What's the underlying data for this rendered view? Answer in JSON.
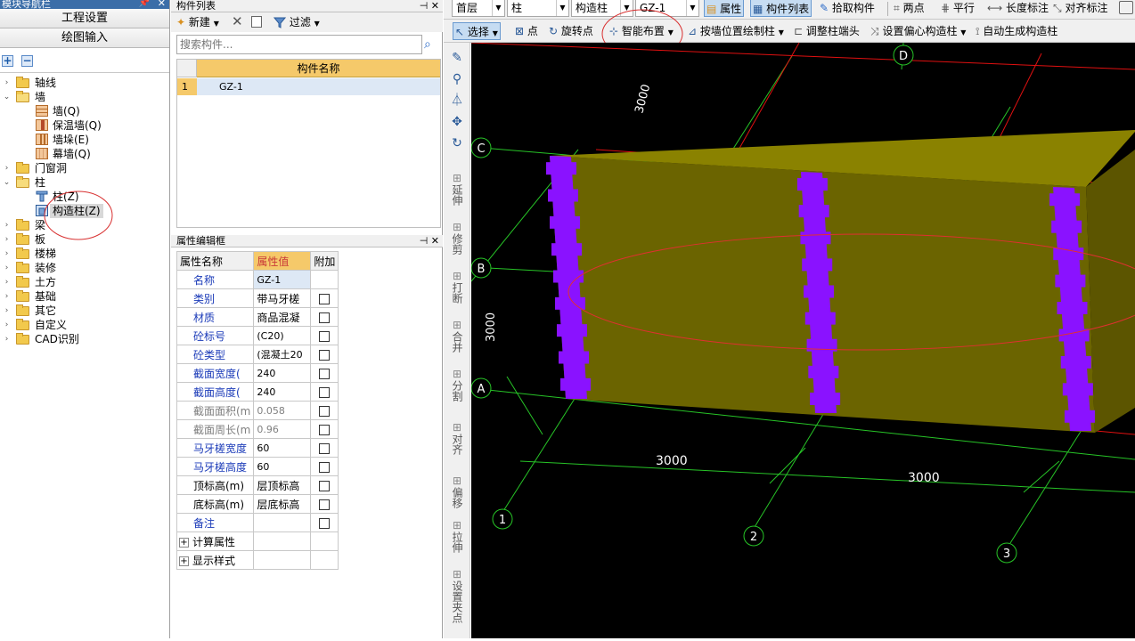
{
  "left_panel": {
    "title": "模块导航栏",
    "buttons": [
      "工程设置",
      "绘图输入"
    ],
    "tree": {
      "axis": "轴线",
      "wall": "墙",
      "wall_children": [
        "墙(Q)",
        "保温墙(Q)",
        "墙垛(E)",
        "幕墙(Q)"
      ],
      "door_window": "门窗洞",
      "column": "柱",
      "column_children": [
        "柱(Z)",
        "构造柱(Z)"
      ],
      "beam": "梁",
      "slab": "板",
      "stair": "楼梯",
      "decoration": "装修",
      "earthwork": "土方",
      "foundation": "基础",
      "other": "其它",
      "custom": "自定义",
      "cad": "CAD识别"
    }
  },
  "component_list": {
    "title": "构件列表",
    "new_label": "新建",
    "filter_label": "过滤",
    "search_placeholder": "搜索构件...",
    "header": "构件名称",
    "rows": [
      {
        "index": "1",
        "name": "GZ-1"
      }
    ]
  },
  "properties": {
    "title": "属性编辑框",
    "col_name": "属性名称",
    "col_value": "属性值",
    "col_extra": "附加",
    "rows": [
      {
        "name": "名称",
        "value": "GZ-1",
        "cb": false,
        "color": "blue"
      },
      {
        "name": "类别",
        "value": "带马牙槎",
        "cb": true,
        "color": "blue"
      },
      {
        "name": "材质",
        "value": "商品混凝",
        "cb": true,
        "color": "blue"
      },
      {
        "name": "砼标号",
        "value": "(C20)",
        "cb": true,
        "color": "blue"
      },
      {
        "name": "砼类型",
        "value": "(混凝土20",
        "cb": true,
        "color": "blue"
      },
      {
        "name": "截面宽度(",
        "value": "240",
        "cb": true,
        "color": "blue"
      },
      {
        "name": "截面高度(",
        "value": "240",
        "cb": true,
        "color": "blue"
      },
      {
        "name": "截面面积(m",
        "value": "0.058",
        "cb": true,
        "color": "gray"
      },
      {
        "name": "截面周长(m",
        "value": "0.96",
        "cb": true,
        "color": "gray"
      },
      {
        "name": "马牙槎宽度",
        "value": "60",
        "cb": true,
        "color": "blue"
      },
      {
        "name": "马牙槎高度",
        "value": "60",
        "cb": true,
        "color": "blue"
      },
      {
        "name": "顶标高(m)",
        "value": "层顶标高",
        "cb": true,
        "color": "black"
      },
      {
        "name": "底标高(m)",
        "value": "层底标高",
        "cb": true,
        "color": "black"
      },
      {
        "name": "备注",
        "value": "",
        "cb": true,
        "color": "blue"
      }
    ],
    "groups": [
      "计算属性",
      "显示样式"
    ]
  },
  "toolbar1": {
    "floor": "首层",
    "type": "柱",
    "subtype": "构造柱",
    "component": "GZ-1",
    "attr_label": "属性",
    "list_label": "构件列表",
    "pick_label": "拾取构件",
    "two_point": "两点",
    "parallel": "平行",
    "length_mark": "长度标注",
    "align_mark": "对齐标注"
  },
  "toolbar2": {
    "select": "选择",
    "point": "点",
    "rotate_point": "旋转点",
    "smart_place": "智能布置",
    "by_wall": "按墙位置绘制柱",
    "adjust_end": "调整柱端头",
    "eccentric": "设置偏心构造柱",
    "auto_gen": "自动生成构造柱"
  },
  "vertical_tools": [
    "延伸",
    "修剪",
    "打断",
    "合并",
    "分割",
    "对齐",
    "偏移",
    "拉伸",
    "设置夹点"
  ],
  "viewport": {
    "axis_labels": [
      "D",
      "C",
      "B",
      "A",
      "1",
      "2",
      "3"
    ],
    "dims": [
      "3000",
      "3000",
      "3000",
      "3000"
    ],
    "colors": {
      "wall": "#6b6400",
      "wall_top": "#8a8200",
      "wall_side": "#5c5500",
      "column": "#8a12ff",
      "grid_green": "#27c427",
      "grid_red": "#e01010",
      "mark_red": "#e03030"
    }
  }
}
